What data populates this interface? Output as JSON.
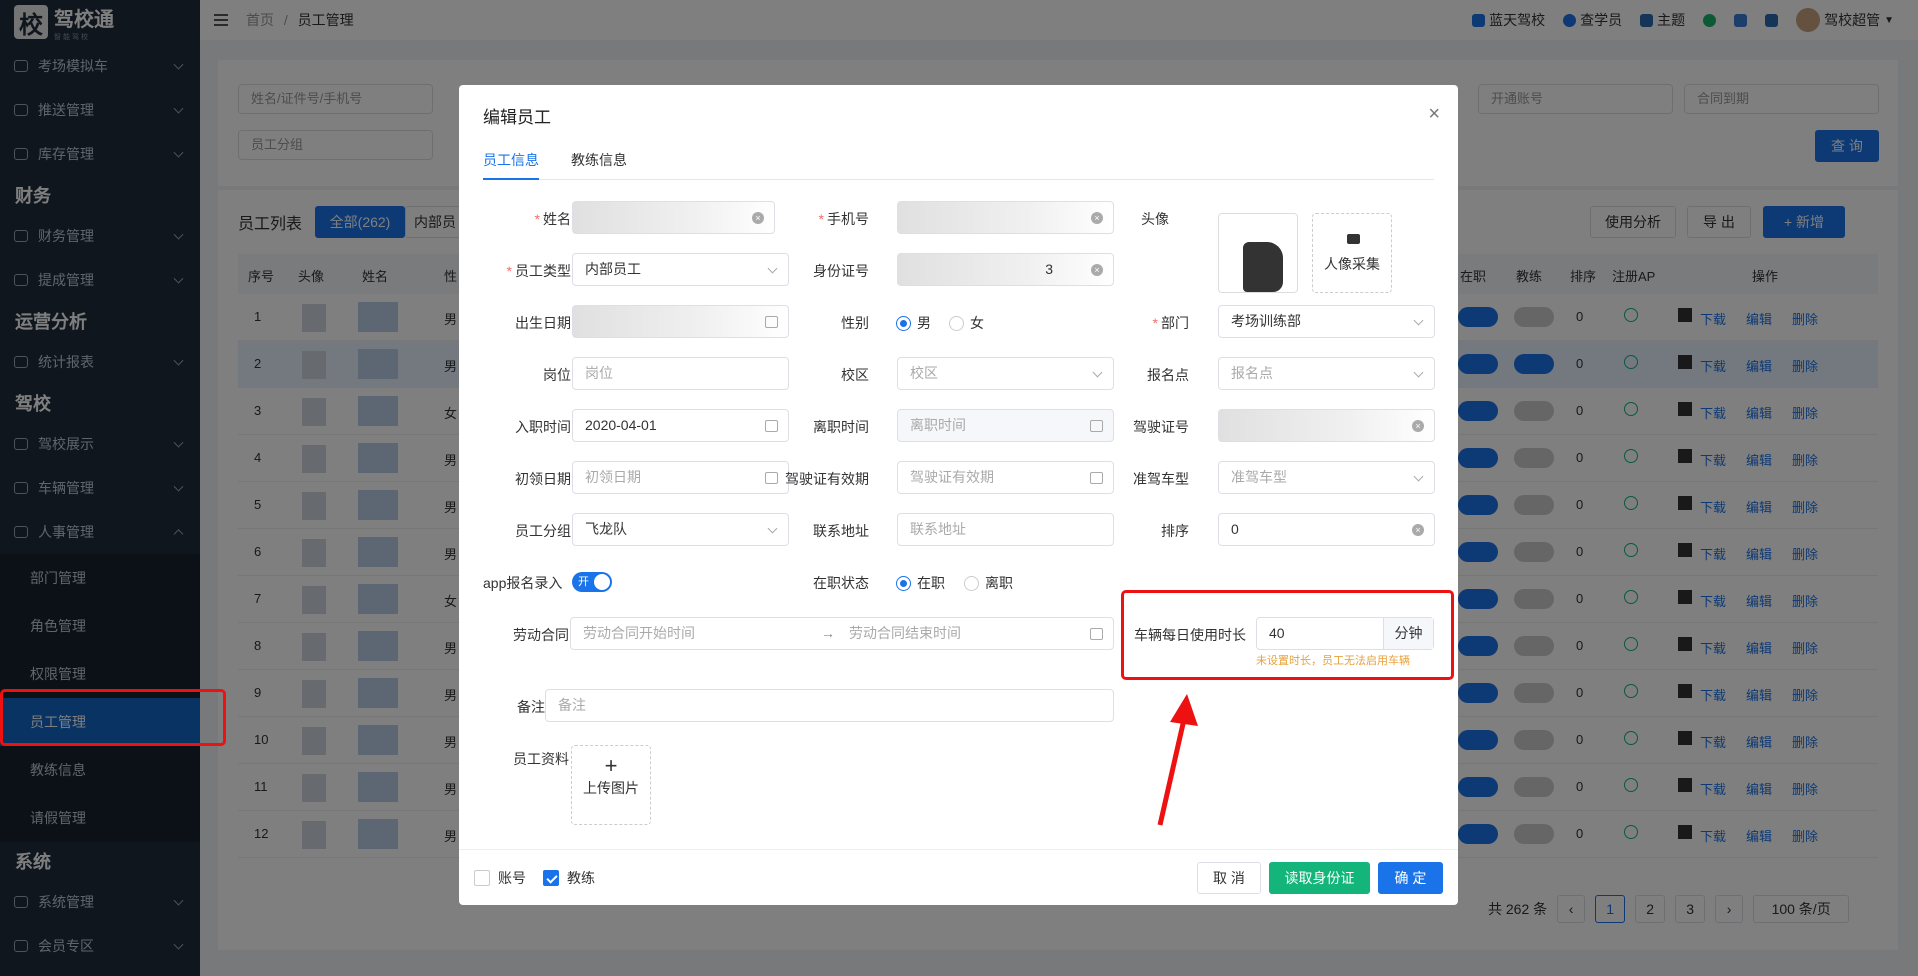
{
  "app": {
    "logo_char": "校",
    "logo_text": "驾校通",
    "logo_sub": "智能驾校"
  },
  "sidebar": {
    "items": [
      {
        "label": "考场模拟车"
      },
      {
        "label": "推送管理"
      },
      {
        "label": "库存管理"
      }
    ],
    "group_finance": "财务",
    "finance_items": [
      {
        "label": "财务管理"
      },
      {
        "label": "提成管理"
      }
    ],
    "group_ops": "运营分析",
    "ops_items": [
      {
        "label": "统计报表"
      }
    ],
    "group_school": "驾校",
    "school_items": [
      {
        "label": "驾校展示"
      },
      {
        "label": "车辆管理"
      },
      {
        "label": "人事管理"
      }
    ],
    "hr_sub": [
      {
        "label": "部门管理"
      },
      {
        "label": "角色管理"
      },
      {
        "label": "权限管理"
      },
      {
        "label": "员工管理"
      },
      {
        "label": "教练信息"
      },
      {
        "label": "请假管理"
      }
    ],
    "group_system": "系统",
    "system_items": [
      {
        "label": "系统管理"
      },
      {
        "label": "会员专区"
      }
    ]
  },
  "topbar": {
    "breadcrumb_home": "首页",
    "breadcrumb_sep": "/",
    "breadcrumb_current": "员工管理",
    "links": [
      "蓝天驾校",
      "查学员",
      "主题"
    ],
    "user": "驾校超管"
  },
  "background": {
    "search_placeholder": "姓名/证件号/手机号",
    "group_placeholder": "员工分组",
    "open_account": "开通账号",
    "contract_due": "合同到期",
    "query_btn": "查 询",
    "list_title": "员工列表",
    "tab_all": "全部(262)",
    "tab_internal": "内部员",
    "analysis_btn": "使用分析",
    "export_btn": "导 出",
    "add_btn": "+ 新增",
    "headers": [
      "序号",
      "头像",
      "姓名",
      "性",
      "在职",
      "教练",
      "排序",
      "注册AP",
      "操作"
    ],
    "row_numbers": [
      "1",
      "2",
      "3",
      "4",
      "5",
      "6",
      "7",
      "8",
      "9",
      "10",
      "11",
      "12"
    ],
    "row_sexes": [
      "男",
      "男",
      "女",
      "男",
      "男",
      "男",
      "女",
      "男",
      "男",
      "男",
      "男",
      "男"
    ],
    "row_sort": "0",
    "row_actions": [
      "下载",
      "编辑",
      "删除"
    ],
    "total": "共 262 条",
    "pages": [
      "1",
      "2",
      "3"
    ],
    "per_page": "100 条/页"
  },
  "dialog": {
    "title": "编辑员工",
    "tabs": [
      "员工信息",
      "教练信息"
    ],
    "labels": {
      "name": "姓名",
      "phone": "手机号",
      "avatar": "头像",
      "type": "员工类型",
      "idcard": "身份证号",
      "birth": "出生日期",
      "sex": "性别",
      "dept": "部门",
      "post": "岗位",
      "campus": "校区",
      "signup": "报名点",
      "join": "入职时间",
      "leave": "离职时间",
      "license": "驾驶证号",
      "firstget": "初领日期",
      "license_valid": "驾驶证有效期",
      "car_type": "准驾车型",
      "group": "员工分组",
      "address": "联系地址",
      "sort": "排序",
      "app_signup": "app报名录入",
      "status": "在职状态",
      "contract": "劳动合同",
      "daily_use": "车辆每日使用时长",
      "remark": "备注",
      "docs": "员工资料"
    },
    "values": {
      "type": "内部员工",
      "idcard_tail": "3",
      "dept": "考场训练部",
      "join": "2020-04-01",
      "group": "飞龙队",
      "sort": "0",
      "daily_use": "40",
      "daily_unit": "分钟"
    },
    "placeholders": {
      "post": "岗位",
      "campus": "校区",
      "signup": "报名点",
      "leave": "离职时间",
      "firstget": "初领日期",
      "license_valid": "驾驶证有效期",
      "car_type": "准驾车型",
      "address": "联系地址",
      "contract_start": "劳动合同开始时间",
      "contract_end": "劳动合同结束时间",
      "remark": "备注"
    },
    "sex_options": [
      "男",
      "女"
    ],
    "status_options": [
      "在职",
      "离职"
    ],
    "switch_text": "开",
    "contract_arrow": "→",
    "warn": "未设置时长，员工无法启用车辆",
    "capture": "人像采集",
    "upload": "上传图片",
    "upload_plus": "+",
    "close": "×",
    "footer": {
      "chk_account": "账号",
      "chk_coach": "教练",
      "cancel": "取 消",
      "read_id": "读取身份证",
      "ok": "确 定"
    }
  }
}
